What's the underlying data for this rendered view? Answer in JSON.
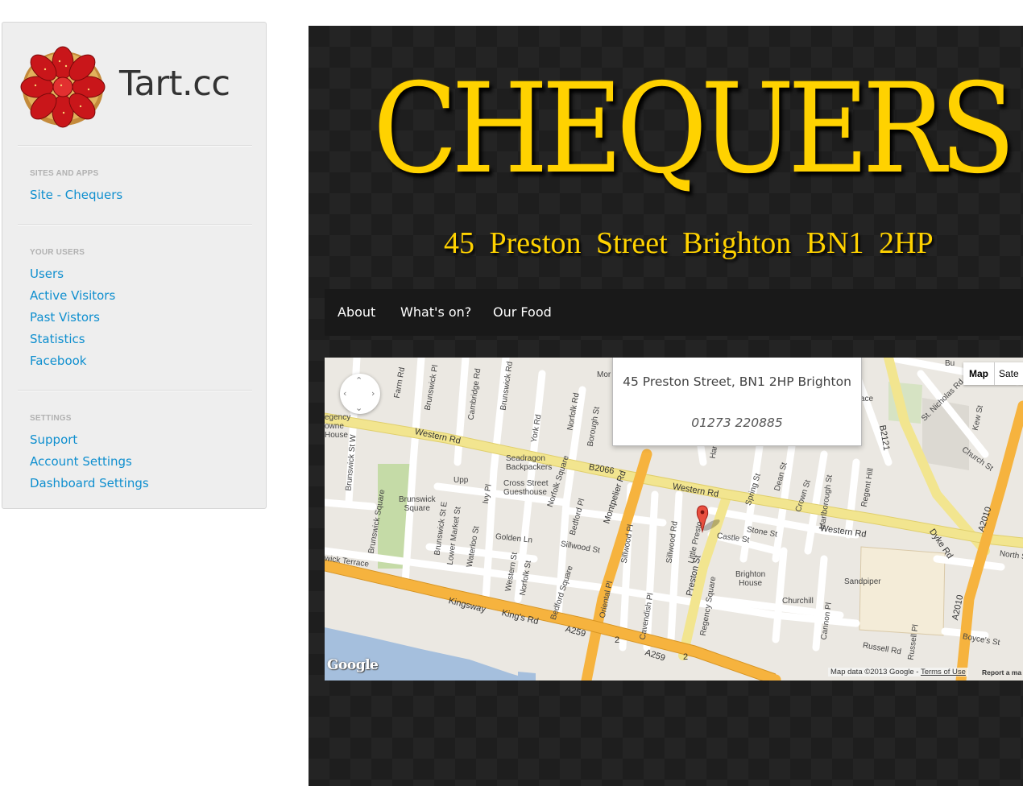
{
  "sidebar": {
    "brand": {
      "title": "Tart.cc"
    },
    "sections": [
      {
        "header": "SITES AND APPS",
        "links": [
          "Site - Chequers"
        ]
      },
      {
        "header": "YOUR USERS",
        "links": [
          "Users",
          "Active Visitors",
          "Past Vistors",
          "Statistics",
          "Facebook"
        ]
      },
      {
        "header": "SETTINGS",
        "links": [
          "Support",
          "Account Settings",
          "Dashboard Settings"
        ]
      }
    ]
  },
  "site": {
    "title": "CHEQUERS",
    "address": "45 Preston Street Brighton BN1 2HP",
    "nav": [
      "About",
      "What's on?",
      "Our Food"
    ],
    "map": {
      "type_buttons": {
        "map": "Map",
        "satellite": "Sate"
      },
      "info": {
        "address": "45 Preston Street, BN1 2HP Brighton",
        "phone": "01273 220885"
      },
      "labels": {
        "western_rd": "Western Rd",
        "western_rd_2": "Western Rd",
        "western_rd_3": "Western Rd",
        "b2066": "B2066",
        "seadragon": "Seadragon\nBackpackers",
        "cross_street": "Cross Street\nGuesthouse",
        "brunswick_square": "Brunswick\nSquare",
        "regency_house": "egency\nowne\nHouse",
        "kingsway": "Kingsway",
        "kings_rd": "King's Rd",
        "a259": "A259",
        "a259_2": "A259",
        "road_2": "2",
        "road_2b": "2",
        "wick_terrace": "wick Terrace",
        "montpelier_rd": "Montpelier Rd",
        "preston_st": "Preston St",
        "little_preston": "Little Presto",
        "castle_st": "Castle St",
        "stone_st": "Stone St",
        "brighton_house": "Brighton\nHouse",
        "churchill": "Churchill",
        "sandpiper": "Sandpiper",
        "russell_rd": "Russell Rd",
        "boyces_st": "Boyce's St",
        "north_st": "North St",
        "dyke_rd": "Dyke Rd",
        "a2010": "A2010",
        "a2010_2": "A2010",
        "b2121": "B2121",
        "regent_hill": "Regent Hill",
        "golden_ln": "Golden Ln",
        "sillwood_st": "Sillwood St",
        "bedford_pl": "Bedford Pl",
        "york_rd": "York Rd",
        "norfolk_rd": "Norfolk Rd",
        "borough_st": "Borough St",
        "waterloo_st": "Waterloo St",
        "western_st": "Western St",
        "oriental_pl": "Oriental Pl",
        "cavendish_pl": "Cavendish Pl",
        "regency_square": "Regency Square",
        "bedford_square": "Bedford Square",
        "church_st": "Church St",
        "st_nicholas_rd": "St. Nicholas Rd",
        "kew_st": "Kew St",
        "spring_st": "Spring St",
        "dean_st": "Dean St",
        "crown_st": "Crown St",
        "marlborough_st": "Marlborough St",
        "cannon_pl": "Cannon Pl",
        "russell_pl": "Russell Pl",
        "brunswick_square_rd": "Brunswick Square",
        "brunswick_st_w": "Brunswick St W",
        "brunswick_st_e": "Brunswick St E",
        "lower_market_st": "Lower Market St",
        "upper_market": "Upp",
        "farm_rd": "Farm Rd",
        "brunswick_pl": "Brunswick Pl",
        "cambridge_rd": "Cambridge Rd",
        "brunswick_rd": "Brunswick Rd",
        "norfolk_square": "Norfolk Square",
        "norfolk_st": "Norfolk St",
        "ivy_pl": "Ivy Pl",
        "sillwood_pl": "Sillwood Pl",
        "sillwood_rd": "Sillwood Rd",
        "hampton": "Ham",
        "more": "Mor",
        "ace": "ace",
        "bud": "Bu"
      },
      "google": "Google",
      "attribution": "Map data ©2013 Google -",
      "terms": "Terms of Use",
      "report": "Report a ma"
    }
  }
}
